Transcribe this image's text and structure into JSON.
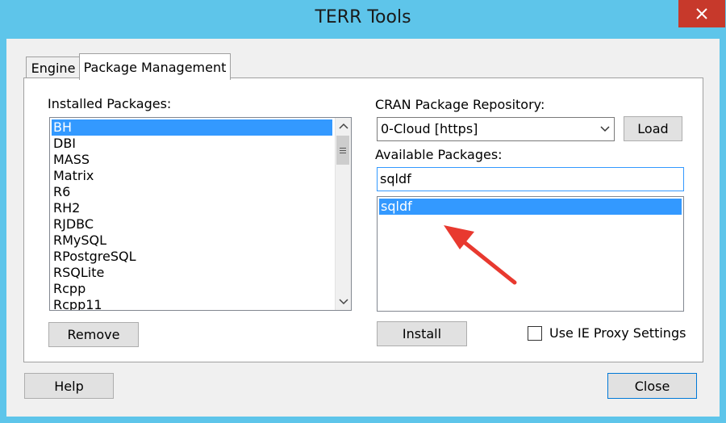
{
  "window": {
    "title": "TERR Tools"
  },
  "tabs": [
    {
      "label": "Engine"
    },
    {
      "label": "Package Management"
    }
  ],
  "installed": {
    "label": "Installed Packages:",
    "items": [
      "BH",
      "DBI",
      "MASS",
      "Matrix",
      "R6",
      "RH2",
      "RJDBC",
      "RMySQL",
      "RPostgreSQL",
      "RSQLite",
      "Rcpp",
      "Rcpp11"
    ],
    "selected_index": 0
  },
  "repository": {
    "label": "CRAN Package Repository:",
    "selected": "0-Cloud [https]",
    "load_label": "Load"
  },
  "available": {
    "label": "Available Packages:",
    "search_value": "sqldf",
    "items": [
      "sqldf"
    ],
    "selected_index": 0
  },
  "buttons": {
    "remove": "Remove",
    "install": "Install",
    "help": "Help",
    "close": "Close"
  },
  "proxy": {
    "label": "Use IE Proxy Settings",
    "checked": false
  },
  "colors": {
    "selection": "#3399ff",
    "title_bg": "#5ec5ea",
    "close_btn": "#c7392b",
    "annotation_arrow": "#e8392f"
  },
  "icons": [
    "close-icon",
    "scroll-up-icon",
    "scroll-down-icon",
    "scroll-thumb-grip-icon",
    "chevron-down-icon",
    "annotation-arrow"
  ]
}
